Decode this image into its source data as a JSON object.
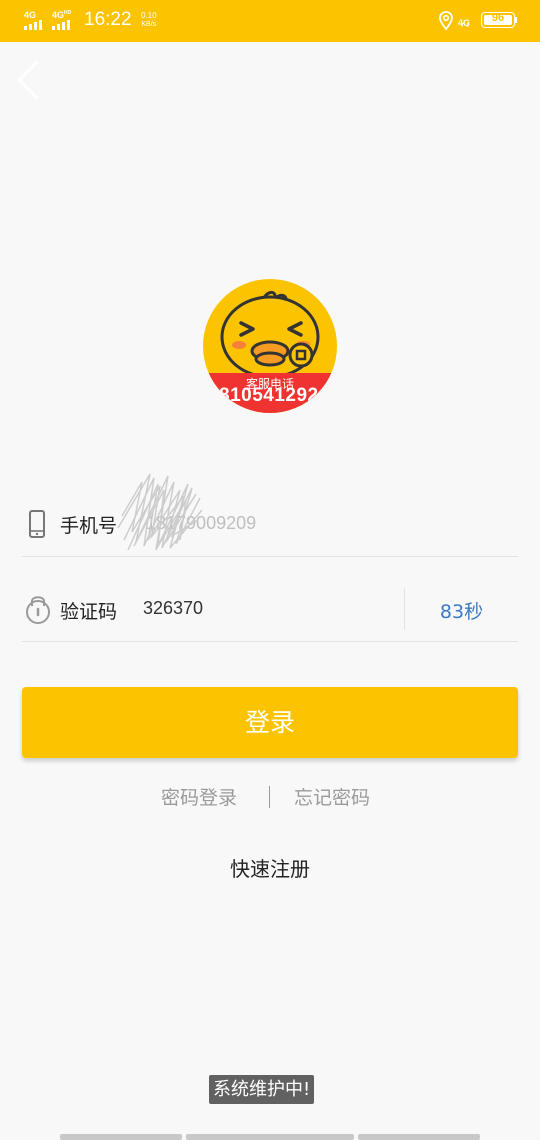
{
  "status_bar": {
    "network_left_1": "4G",
    "network_left_2": "4G",
    "network_left_2_suffix": "HD",
    "time": "16:22",
    "speed_value": "0.10",
    "speed_unit": "KB/s",
    "network_right": "4G",
    "battery": "96",
    "background_color": "#fcc400"
  },
  "header": {
    "back_icon": "chevron-left-icon"
  },
  "logo": {
    "caption": "客服电话",
    "phone": "810541292"
  },
  "form": {
    "phone_label": "手机号",
    "phone_value": "18179009209",
    "phone_icon": "phone-icon",
    "code_label": "验证码",
    "code_value": "326370",
    "code_icon": "lock-icon",
    "countdown": "83秒"
  },
  "actions": {
    "login_label": "登录",
    "password_login": "密码登录",
    "forgot_password": "忘记密码",
    "quick_register": "快速注册"
  },
  "toast": {
    "message": "系统维护中!"
  },
  "colors": {
    "accent": "#fcc400",
    "link_blue": "#3b79c5",
    "logo_band": "#ee3330"
  }
}
